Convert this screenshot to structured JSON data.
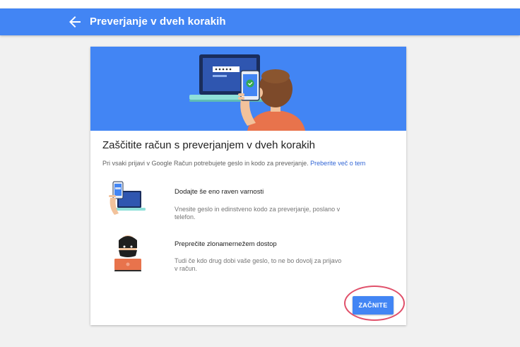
{
  "appbar": {
    "back_icon": "arrow-back-icon",
    "title": "Preverjanje v dveh korakih",
    "color": "#4285f4"
  },
  "card": {
    "title": "Zaščitite račun s preverjanjem v dveh korakih",
    "intro_text": "Pri vsaki prijavi v Google Račun potrebujete geslo in kodo za preverjanje.",
    "intro_link": "Preberite več o tem",
    "features": [
      {
        "icon": "phone-laptop-icon",
        "title": "Dodajte še eno raven varnosti",
        "description": "Vnesite geslo in edinstveno kodo za preverjanje, poslano v telefon."
      },
      {
        "icon": "hacker-icon",
        "title": "Preprečite zlonamernežem dostop",
        "description": "Tudi če kdo drug dobi vaše geslo, to ne bo dovolj za prijavo v račun."
      }
    ],
    "start_button": "ZAČNITE"
  },
  "annotation": {
    "highlight_color": "#e0506a"
  }
}
